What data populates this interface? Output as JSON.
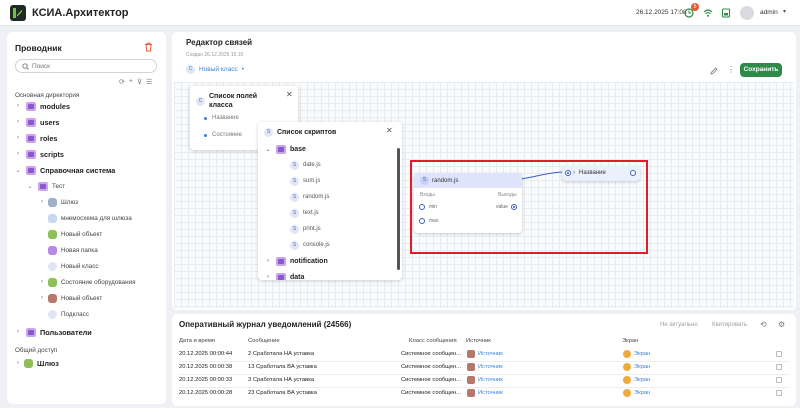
{
  "header": {
    "app_title": "КСИА.Архитектор",
    "datetime": "26.12.2025 17:08",
    "notif_count": "5",
    "user": "admin"
  },
  "sidebar": {
    "title": "Проводник",
    "search_placeholder": "Поиск",
    "section_main": "Основная директория",
    "section_shared": "Общий доступ",
    "items": [
      {
        "label": "modules"
      },
      {
        "label": "users"
      },
      {
        "label": "roles"
      },
      {
        "label": "scripts"
      },
      {
        "label": "Справочная система"
      },
      {
        "label": "Тест"
      },
      {
        "label": "Шлюз"
      },
      {
        "label": "мнемосхема для шлюза"
      },
      {
        "label": "Новый объект"
      },
      {
        "label": "Новая папка"
      },
      {
        "label": "Новый класс"
      },
      {
        "label": "Состояние оборудования"
      },
      {
        "label": "Новый объект"
      },
      {
        "label": "Подкласс"
      },
      {
        "label": "Пользователи"
      },
      {
        "label": "Шлюз"
      }
    ]
  },
  "editor": {
    "title": "Редактор связей",
    "created": "Создан 26.12.2025 15:10",
    "class_name": "Новый класс",
    "save_label": "Сохранить",
    "fields_panel": {
      "title": "Список полей класса",
      "fields": [
        "Название",
        "Состояние"
      ]
    },
    "scripts_panel": {
      "title": "Список скриптов",
      "folder_base": "base",
      "scripts": [
        "date.js",
        "sum.js",
        "random.js",
        "text.js",
        "print.js",
        "console.js"
      ],
      "folder_notification": "notification",
      "folder_data": "data"
    },
    "node": {
      "title": "random.js",
      "inputs_label": "Входы",
      "outputs_label": "Выходы",
      "inputs": [
        "min",
        "max"
      ],
      "output": "value"
    },
    "output_node": {
      "label": "Название"
    }
  },
  "journal": {
    "title": "Оперативный журнал уведомлений (24566)",
    "btn_irrelevant": "Не актуально",
    "btn_quote": "Квитировать",
    "columns": [
      "Дата и время",
      "Сообщение",
      "Класс сообщения",
      "Источник",
      "Экран"
    ],
    "rows": [
      {
        "dt": "20.12.2025 00:00:44",
        "msg": "2 Сработала НА уставка",
        "cls": "Системное сообщен...",
        "src": "Источник",
        "scr": "Экран"
      },
      {
        "dt": "20.12.2025 00:00:38",
        "msg": "13 Сработала ВА уставка",
        "cls": "Системное сообщен...",
        "src": "Источник",
        "scr": "Экран"
      },
      {
        "dt": "20.12.2025 00:00:33",
        "msg": "3 Сработала НА уставка",
        "cls": "Системное сообщен...",
        "src": "Источник",
        "scr": "Экран"
      },
      {
        "dt": "20.12.2025 00:00:28",
        "msg": "23 Сработала ВА уставка",
        "cls": "Системное сообщен...",
        "src": "Источник",
        "scr": "Экран"
      }
    ]
  }
}
